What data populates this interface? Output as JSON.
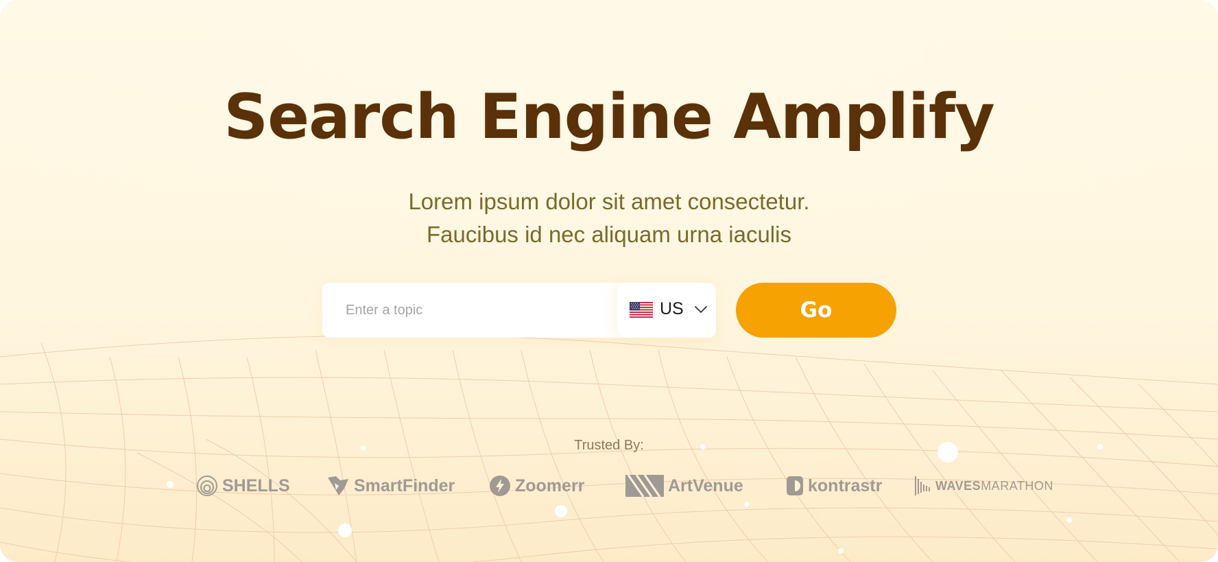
{
  "hero": {
    "title": "Search Engine Amplify",
    "subtitle_line1": "Lorem ipsum dolor sit amet consectetur.",
    "subtitle_line2": "Faucibus id nec aliquam urna iaculis"
  },
  "search": {
    "placeholder": "Enter a topic",
    "value": "",
    "country": {
      "code": "US",
      "flag_icon": "us-flag-icon"
    },
    "go_label": "Go"
  },
  "trusted": {
    "label": "Trusted By:",
    "logos": [
      {
        "name": "SHELLS",
        "icon": "spiral-icon"
      },
      {
        "name": "SmartFinder",
        "icon": "smartfinder-icon"
      },
      {
        "name": "Zoomerr",
        "icon": "lightning-icon"
      },
      {
        "name": "ArtVenue",
        "icon": "artvenue-icon"
      },
      {
        "name": "kontrastr",
        "icon": "kontrastr-icon"
      },
      {
        "name_bold": "WAVES",
        "name_light": "MARATHON",
        "icon": "waveform-icon"
      }
    ]
  },
  "colors": {
    "title": "#5a3108",
    "subtitle": "#7a6a2a",
    "accent": "#f5a202",
    "logo": "#a09a94",
    "background": "#fff8e4"
  }
}
